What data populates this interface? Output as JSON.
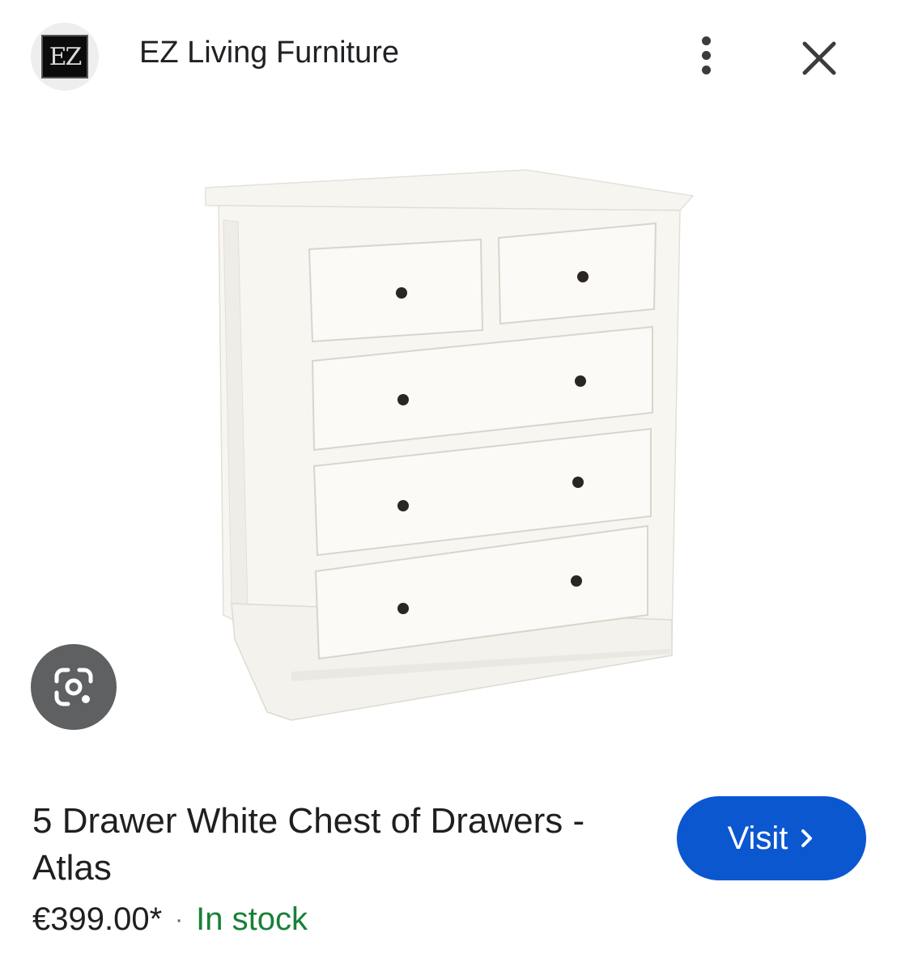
{
  "header": {
    "favicon_text": "EZ",
    "site_name": "EZ Living Furniture",
    "menu_icon": "more-vert-icon",
    "close_icon": "close-icon"
  },
  "product": {
    "image_icon": "chest-of-drawers-image",
    "lens_icon": "google-lens-icon",
    "title": "5 Drawer White Chest of Drawers - Atlas",
    "price": "€399.00*",
    "separator": "·",
    "availability": "In stock"
  },
  "actions": {
    "visit_label": "Visit",
    "visit_icon": "chevron-right-icon"
  },
  "colors": {
    "visit_button": "#0b57d0",
    "in_stock": "#188038",
    "lens_button": "#5f6061"
  }
}
